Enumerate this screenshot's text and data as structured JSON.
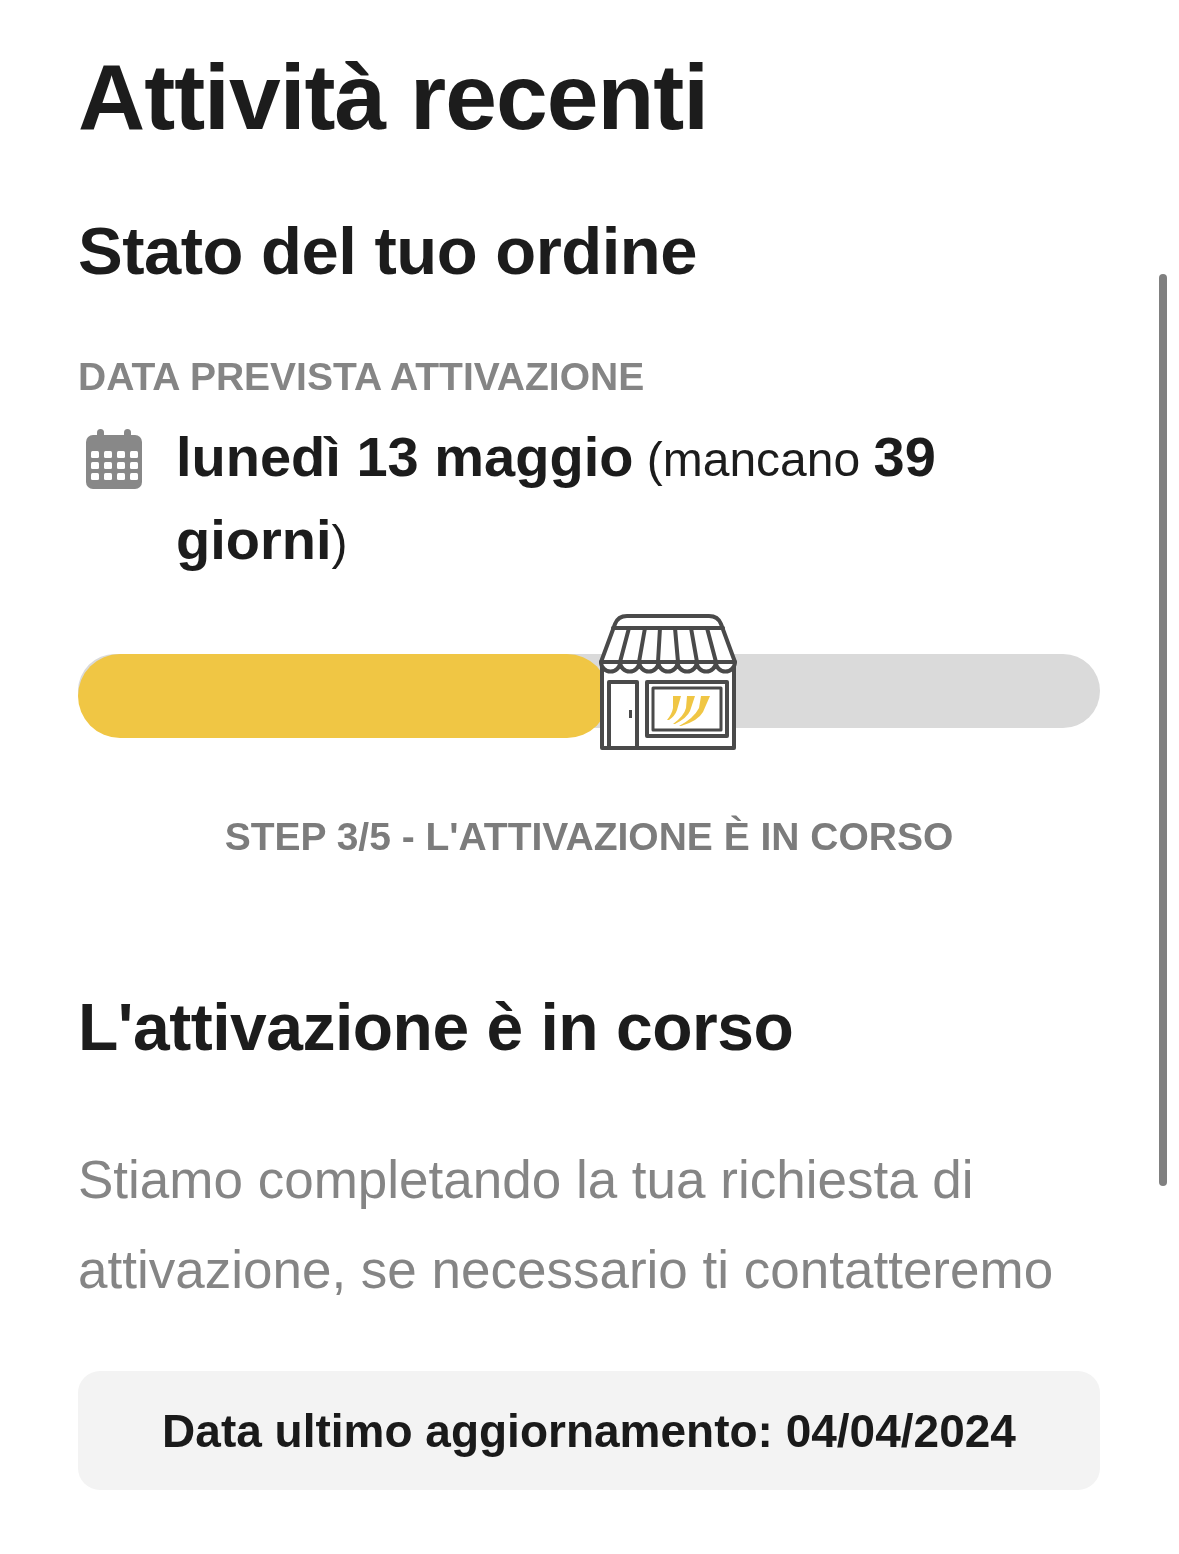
{
  "page": {
    "title": "Attività recenti"
  },
  "order_status": {
    "title": "Stato del tuo ordine",
    "date_label": "DATA PREVISTA ATTIVAZIONE",
    "date_text": "**lunedì 13 maggio** (mancano **39 giorni**)"
  },
  "progress": {
    "level": 0.52,
    "step_text": "STEP 3/5 - L'ATTIVAZIONE È IN CORSO"
  },
  "status": {
    "title": "L'attivazione è in corso",
    "description": "Stiamo completando la tua richiesta di attivazione, se necessario ti contatteremo"
  },
  "last_update": {
    "text": "Data ultimo aggiornamento: 04/04/2024"
  }
}
